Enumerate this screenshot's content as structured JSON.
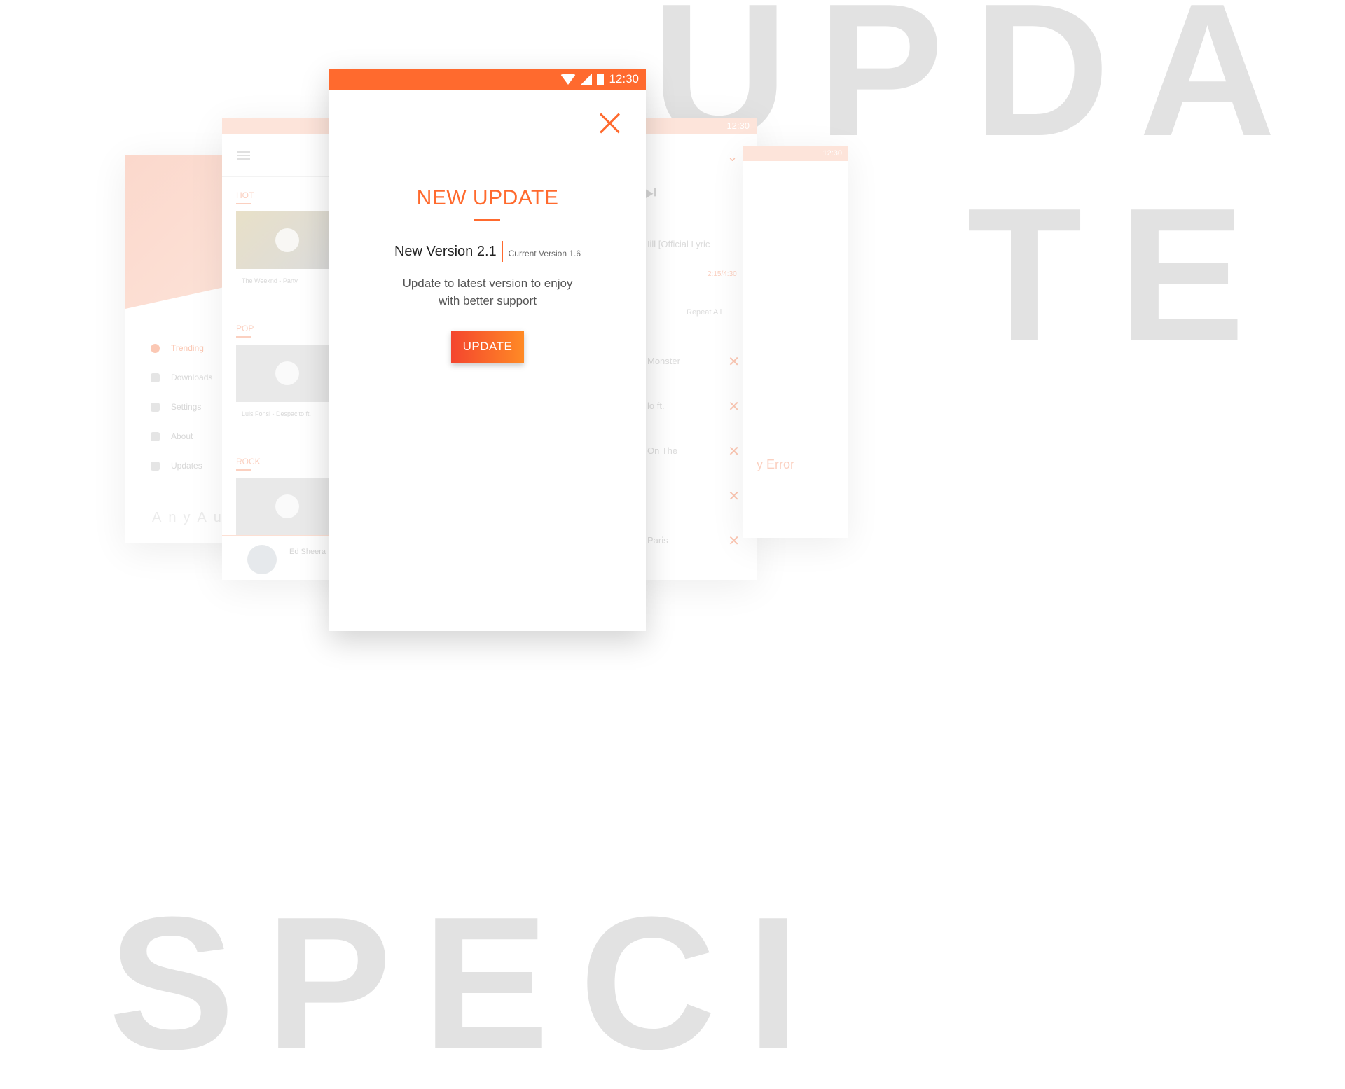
{
  "background_text": {
    "top_line": "UPDA",
    "second_line": "TE",
    "bottom_line": "SPECI"
  },
  "colors": {
    "accent": "#ff6a2e",
    "button_start": "#f4452e",
    "button_end": "#ff8a25",
    "ghost_text": "#e2e2e2"
  },
  "dialog": {
    "status_time": "12:30",
    "title": "NEW UPDATE",
    "new_version": "New Version 2.1",
    "current_version": "Current Version 1.6",
    "message_line1": "Update to latest version to enjoy",
    "message_line2": "with better support",
    "button_label": "UPDATE",
    "close_icon": "close-icon"
  },
  "ghost_screens": {
    "drawer": {
      "menu": [
        "Trending",
        "Downloads",
        "Settings",
        "About",
        "Updates"
      ],
      "brand": "AnyAu"
    },
    "list": {
      "sections": [
        "HOT",
        "POP",
        "ROCK"
      ],
      "captions": [
        "The Weeknd - Party",
        "Luis Fonsi - Despacito ft."
      ],
      "now_playing": "Ed Sheera"
    },
    "player": {
      "status_time": "12:30",
      "track": "he Hill [Official Lyric",
      "time": "2:15/4:30",
      "repeat": "Repeat All",
      "queue": [
        "Monster",
        "lo ft.",
        "On The",
        "",
        "Paris"
      ]
    },
    "side": {
      "status_time": "12:30",
      "text": "y Error"
    }
  }
}
